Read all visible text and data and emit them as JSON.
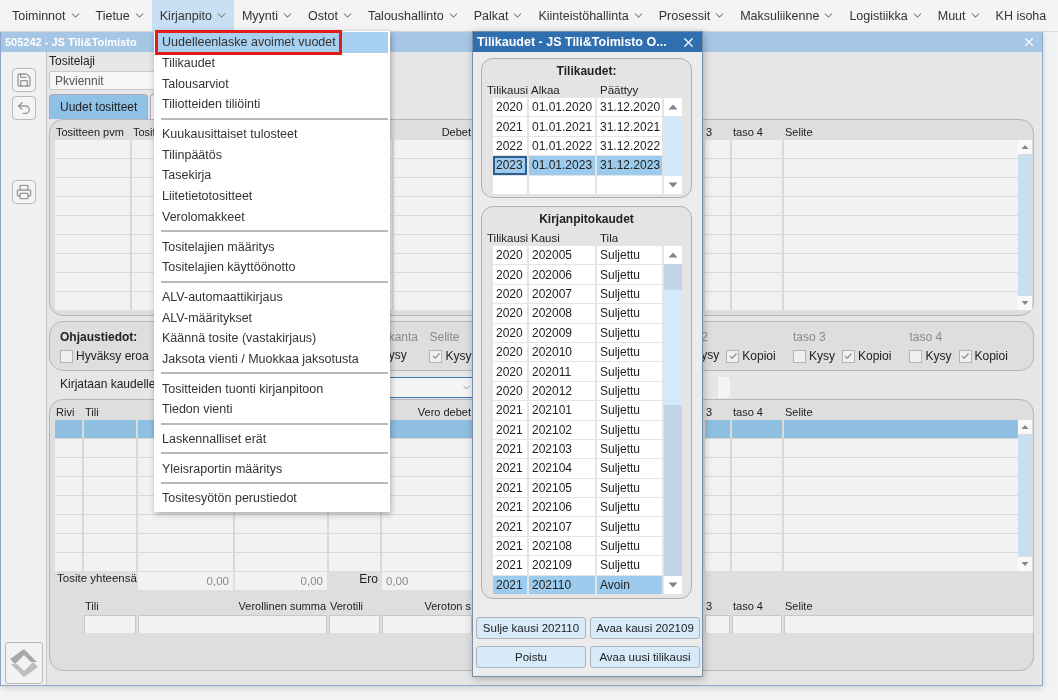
{
  "menu_bar": {
    "items": [
      {
        "label": "Toiminnot",
        "selected": false,
        "dropdown": true
      },
      {
        "label": "Tietue",
        "selected": false,
        "dropdown": true
      },
      {
        "label": "Kirjanpito",
        "selected": true,
        "dropdown": true
      },
      {
        "label": "Myynti",
        "selected": false,
        "dropdown": true
      },
      {
        "label": "Ostot",
        "selected": false,
        "dropdown": true
      },
      {
        "label": "Taloushallinto",
        "selected": false,
        "dropdown": true
      },
      {
        "label": "Palkat",
        "selected": false,
        "dropdown": true
      },
      {
        "label": "Kiinteistöhallinta",
        "selected": false,
        "dropdown": true
      },
      {
        "label": "Prosessit",
        "selected": false,
        "dropdown": true
      },
      {
        "label": "Maksuliikenne",
        "selected": false,
        "dropdown": true
      },
      {
        "label": "Logistiikka",
        "selected": false,
        "dropdown": true
      },
      {
        "label": "Muut",
        "selected": false,
        "dropdown": true
      },
      {
        "label": "KH isoha",
        "selected": false,
        "dropdown": false
      }
    ]
  },
  "dropdown_menu": {
    "groups": [
      {
        "items": [
          {
            "label": "Uudelleenlaske avoimet vuodet",
            "selected": true,
            "annotated": true
          },
          {
            "label": "Tilikaudet",
            "selected": false,
            "annotated": false
          },
          {
            "label": "Talousarviot",
            "selected": false,
            "annotated": false
          },
          {
            "label": "Tiliotteiden tiliöinti",
            "selected": false,
            "annotated": false
          }
        ]
      },
      {
        "items": [
          {
            "label": "Kuukausittaiset tulosteet",
            "selected": false,
            "annotated": false
          },
          {
            "label": "Tilinpäätös",
            "selected": false,
            "annotated": false
          },
          {
            "label": "Tasekirja",
            "selected": false,
            "annotated": false
          },
          {
            "label": "Liitetietotositteet",
            "selected": false,
            "annotated": false
          },
          {
            "label": "Verolomakkeet",
            "selected": false,
            "annotated": false
          }
        ]
      },
      {
        "items": [
          {
            "label": "Tositelajien määritys",
            "selected": false,
            "annotated": false
          },
          {
            "label": "Tositelajien käyttöönotto",
            "selected": false,
            "annotated": false
          }
        ]
      },
      {
        "items": [
          {
            "label": "ALV-automaattikirjaus",
            "selected": false,
            "annotated": false
          },
          {
            "label": "ALV-määritykset",
            "selected": false,
            "annotated": false
          },
          {
            "label": "Käännä tosite (vastakirjaus)",
            "selected": false,
            "annotated": false
          },
          {
            "label": "Jaksota vienti / Muokkaa jaksotusta",
            "selected": false,
            "annotated": false
          }
        ]
      },
      {
        "items": [
          {
            "label": "Tositteiden tuonti kirjanpitoon",
            "selected": false,
            "annotated": false
          },
          {
            "label": "Tiedon vienti",
            "selected": false,
            "annotated": false
          }
        ]
      },
      {
        "items": [
          {
            "label": "Laskennalliset erät",
            "selected": false,
            "annotated": false
          }
        ]
      },
      {
        "items": [
          {
            "label": "Yleisraportin määritys",
            "selected": false,
            "annotated": false
          }
        ]
      },
      {
        "items": [
          {
            "label": "Tositesyötön perustiedot",
            "selected": false,
            "annotated": false
          }
        ]
      }
    ]
  },
  "main_window": {
    "title": "505242 - JS Tili&Toimisto",
    "voucher_type": {
      "label": "Tositelaji",
      "value": "Pkviennit"
    },
    "tabs": [
      {
        "label": "Uudet tositteet",
        "selected": true
      },
      {
        "selected": false
      }
    ],
    "voucher_grid": {
      "columns": [
        "Tositteen pvm",
        "Tosit",
        "Debet",
        "3",
        "taso 4",
        "Selite"
      ],
      "rows": [
        {
          "selected": false
        },
        {
          "selected": false
        },
        {
          "selected": false
        },
        {
          "selected": false
        },
        {
          "selected": false
        },
        {
          "selected": false
        },
        {
          "selected": false
        },
        {
          "selected": false
        },
        {
          "selected": false
        }
      ]
    },
    "control_panel": {
      "title": "Ohjaustiedot:",
      "groups": [
        {
          "items": [
            {
              "kind": "checkbox",
              "label": "Hyväksy eroa",
              "checked": false
            }
          ]
        },
        {
          "header": "kanta",
          "items": [
            {
              "kind": "text",
              "label": "ysy"
            }
          ]
        },
        {
          "header": "Selite",
          "items": [
            {
              "kind": "checkbox",
              "label": "Kysy",
              "checked": true
            }
          ]
        },
        {
          "header": "2",
          "items": [
            {
              "kind": "text",
              "label": "ysy"
            },
            {
              "kind": "checkbox",
              "label": "Kopioi",
              "checked": true
            }
          ]
        },
        {
          "header": "taso 3",
          "items": [
            {
              "kind": "checkbox",
              "label": "Kysy",
              "checked": false
            },
            {
              "kind": "checkbox",
              "label": "Kopioi",
              "checked": true
            }
          ]
        },
        {
          "header": "taso 4",
          "items": [
            {
              "kind": "checkbox",
              "label": "Kysy",
              "checked": false
            },
            {
              "kind": "checkbox",
              "label": "Kopioi",
              "checked": true
            }
          ]
        }
      ]
    },
    "period": {
      "label": "Kirjataan kaudelle"
    },
    "entry_grid": {
      "columns": [
        "Rivi",
        "Tili",
        "Vero debet",
        "3",
        "taso 4",
        "Selite"
      ],
      "rows": [
        {
          "selected": true
        },
        {
          "selected": false
        },
        {
          "selected": false
        },
        {
          "selected": false
        },
        {
          "selected": false
        },
        {
          "selected": false
        },
        {
          "selected": false
        },
        {
          "selected": false
        }
      ]
    },
    "totals": {
      "label": "Tosite yhteensä",
      "debit": "0,00",
      "credit": "0,00",
      "difference_label": "Ero",
      "difference": "0,00"
    },
    "tax_row": {
      "columns": [
        "Tili",
        "Verollinen summa",
        "Verotili",
        "Veroton s",
        "3",
        "taso 4",
        "Selite"
      ]
    }
  },
  "dialog": {
    "title": "Tilikaudet - JS Tili&Toimisto O...",
    "fiscal_years": {
      "title": "Tilikaudet:",
      "columns": [
        "Tilikausi",
        "Alkaa",
        "Päättyy"
      ],
      "rows": [
        {
          "cells": [
            "2020",
            "01.01.2020",
            "31.12.2020"
          ],
          "selected": false
        },
        {
          "cells": [
            "2021",
            "01.01.2021",
            "31.12.2021"
          ],
          "selected": false
        },
        {
          "cells": [
            "2022",
            "01.01.2022",
            "31.12.2022"
          ],
          "selected": false
        },
        {
          "cells": [
            "2023",
            "01.01.2023",
            "31.12.2023"
          ],
          "selected": true
        }
      ]
    },
    "periods": {
      "title": "Kirjanpitokaudet",
      "columns": [
        "Tilikausi",
        "Kausi",
        "Tila"
      ],
      "rows": [
        {
          "cells": [
            "2020",
            "202005",
            "Suljettu"
          ],
          "selected": false
        },
        {
          "cells": [
            "2020",
            "202006",
            "Suljettu"
          ],
          "selected": false
        },
        {
          "cells": [
            "2020",
            "202007",
            "Suljettu"
          ],
          "selected": false
        },
        {
          "cells": [
            "2020",
            "202008",
            "Suljettu"
          ],
          "selected": false
        },
        {
          "cells": [
            "2020",
            "202009",
            "Suljettu"
          ],
          "selected": false
        },
        {
          "cells": [
            "2020",
            "202010",
            "Suljettu"
          ],
          "selected": false
        },
        {
          "cells": [
            "2020",
            "202011",
            "Suljettu"
          ],
          "selected": false
        },
        {
          "cells": [
            "2020",
            "202012",
            "Suljettu"
          ],
          "selected": false
        },
        {
          "cells": [
            "2021",
            "202101",
            "Suljettu"
          ],
          "selected": false
        },
        {
          "cells": [
            "2021",
            "202102",
            "Suljettu"
          ],
          "selected": false
        },
        {
          "cells": [
            "2021",
            "202103",
            "Suljettu"
          ],
          "selected": false
        },
        {
          "cells": [
            "2021",
            "202104",
            "Suljettu"
          ],
          "selected": false
        },
        {
          "cells": [
            "2021",
            "202105",
            "Suljettu"
          ],
          "selected": false
        },
        {
          "cells": [
            "2021",
            "202106",
            "Suljettu"
          ],
          "selected": false
        },
        {
          "cells": [
            "2021",
            "202107",
            "Suljettu"
          ],
          "selected": false
        },
        {
          "cells": [
            "2021",
            "202108",
            "Suljettu"
          ],
          "selected": false
        },
        {
          "cells": [
            "2021",
            "202109",
            "Suljettu"
          ],
          "selected": false
        },
        {
          "cells": [
            "2021",
            "202110",
            "Avoin"
          ],
          "selected": true
        }
      ]
    },
    "buttons": [
      "Sulje kausi 202110",
      "Avaa kausi 202109",
      "Poistu",
      "Avaa uusi tilikausi"
    ]
  }
}
